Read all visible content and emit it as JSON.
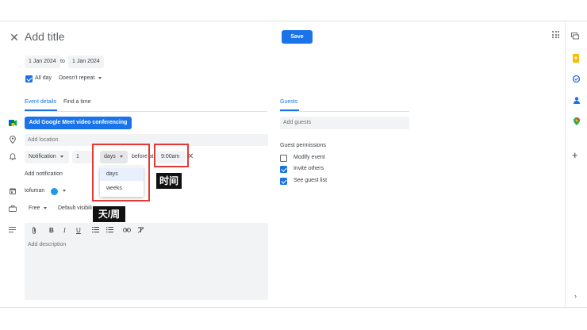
{
  "header": {
    "close_icon": "close-icon",
    "title_placeholder": "Add title",
    "save_label": "Save",
    "apps_icon": "apps-grid-icon"
  },
  "dates": {
    "start": "1 Jan 2024",
    "to": "to",
    "end": "1 Jan 2024",
    "all_day_label": "All day",
    "all_day_checked": true,
    "repeat": "Doesn't repeat"
  },
  "tabs": [
    {
      "label": "Event details",
      "active": true
    },
    {
      "label": "Find a time",
      "active": false
    }
  ],
  "event": {
    "meet_button": "Add Google Meet video conferencing",
    "location_placeholder": "Add location",
    "notification": {
      "type": "Notification",
      "amount": "1",
      "unit": "days",
      "before_at": "before at",
      "time": "9:00am"
    },
    "unit_options": [
      "days",
      "weeks"
    ],
    "add_notification": "Add notification",
    "calendar": {
      "name": "tofuman",
      "color": "#1a9ce8"
    },
    "availability": "Free",
    "visibility": "Default visibili",
    "description_placeholder": "Add description"
  },
  "annotations": {
    "time_label": "时间",
    "unit_label": "天/周",
    "box_color": "#e53935"
  },
  "guests": {
    "tab_label": "Guests",
    "add_placeholder": "Add guests",
    "permissions_title": "Guest permissions",
    "permissions": [
      {
        "label": "Modify event",
        "checked": false
      },
      {
        "label": "Invite others",
        "checked": true
      },
      {
        "label": "See guest list",
        "checked": true
      }
    ]
  },
  "side_panel": {
    "icons": [
      "chat-icon",
      "keep-icon",
      "tasks-icon",
      "contacts-icon",
      "maps-icon",
      "add-icon",
      "expand-icon"
    ]
  },
  "colors": {
    "accent": "#1a73e8",
    "annotation_red": "#e53935"
  }
}
